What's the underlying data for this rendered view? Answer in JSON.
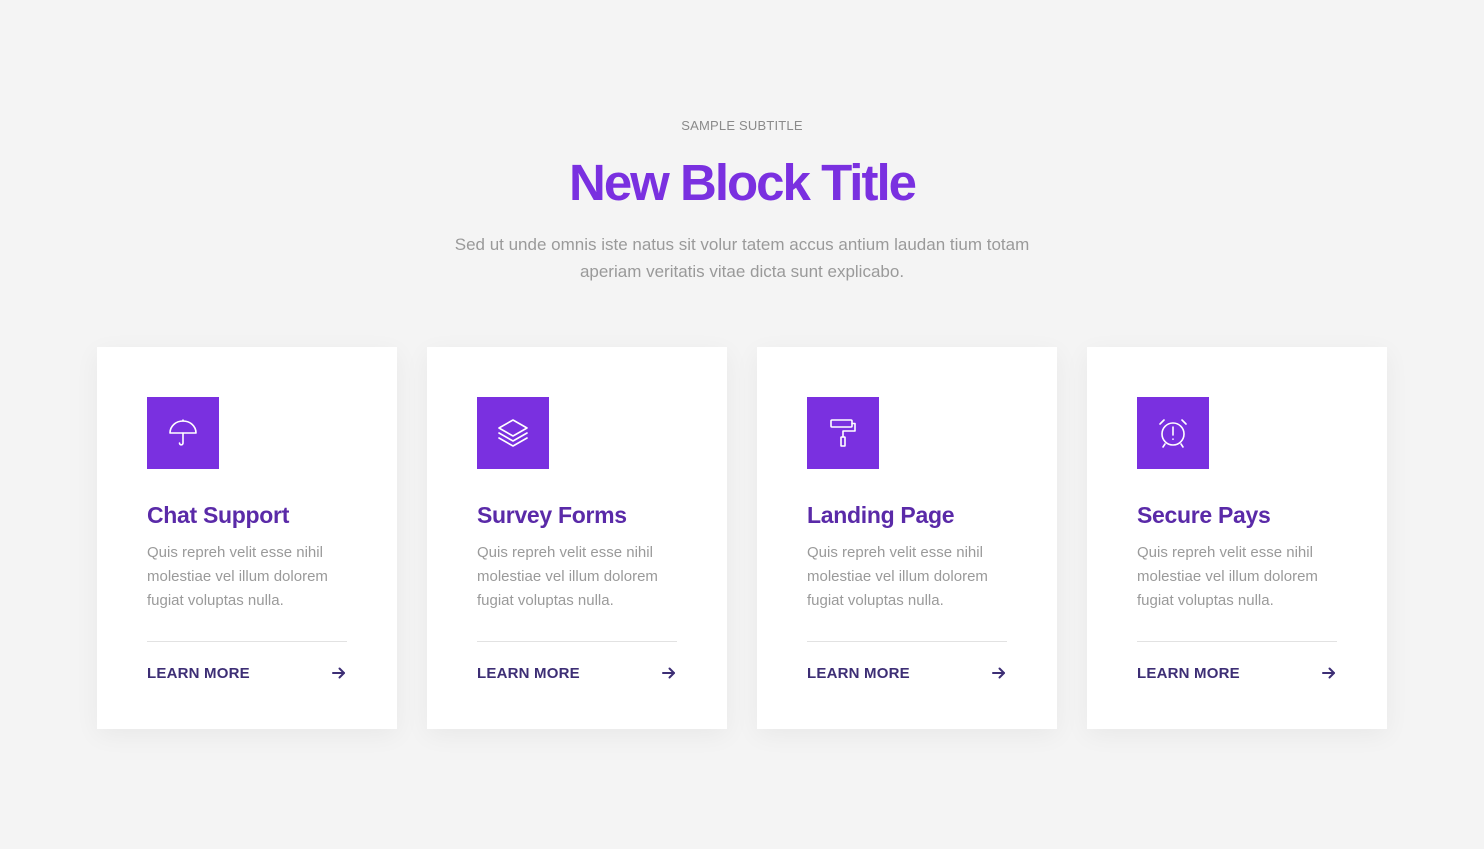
{
  "header": {
    "subtitle": "SAMPLE SUBTITLE",
    "title": "New Block Title",
    "description": "Sed ut unde omnis iste natus sit volur tatem accus antium laudan tium totam aperiam veritatis vitae dicta sunt explicabo."
  },
  "colors": {
    "accent": "#7a30e0",
    "card_title": "#5a2aa8",
    "link": "#3d2e75",
    "background": "#f4f4f4"
  },
  "cards": [
    {
      "icon": "umbrella-icon",
      "title": "Chat Support",
      "text": "Quis repreh velit esse nihil molestiae vel illum dolorem fugiat voluptas nulla.",
      "link_label": "LEARN MORE",
      "link_icon": "arrow-right-icon"
    },
    {
      "icon": "layers-icon",
      "title": "Survey Forms",
      "text": "Quis repreh velit esse nihil molestiae vel illum dolorem fugiat voluptas nulla.",
      "link_label": "LEARN MORE",
      "link_icon": "arrow-right-icon"
    },
    {
      "icon": "paint-roller-icon",
      "title": "Landing Page",
      "text": "Quis repreh velit esse nihil molestiae vel illum dolorem fugiat voluptas nulla.",
      "link_label": "LEARN MORE",
      "link_icon": "arrow-right-icon"
    },
    {
      "icon": "alarm-clock-icon",
      "title": "Secure Pays",
      "text": "Quis repreh velit esse nihil molestiae vel illum dolorem fugiat voluptas nulla.",
      "link_label": "LEARN MORE",
      "link_icon": "arrow-right-icon"
    }
  ]
}
